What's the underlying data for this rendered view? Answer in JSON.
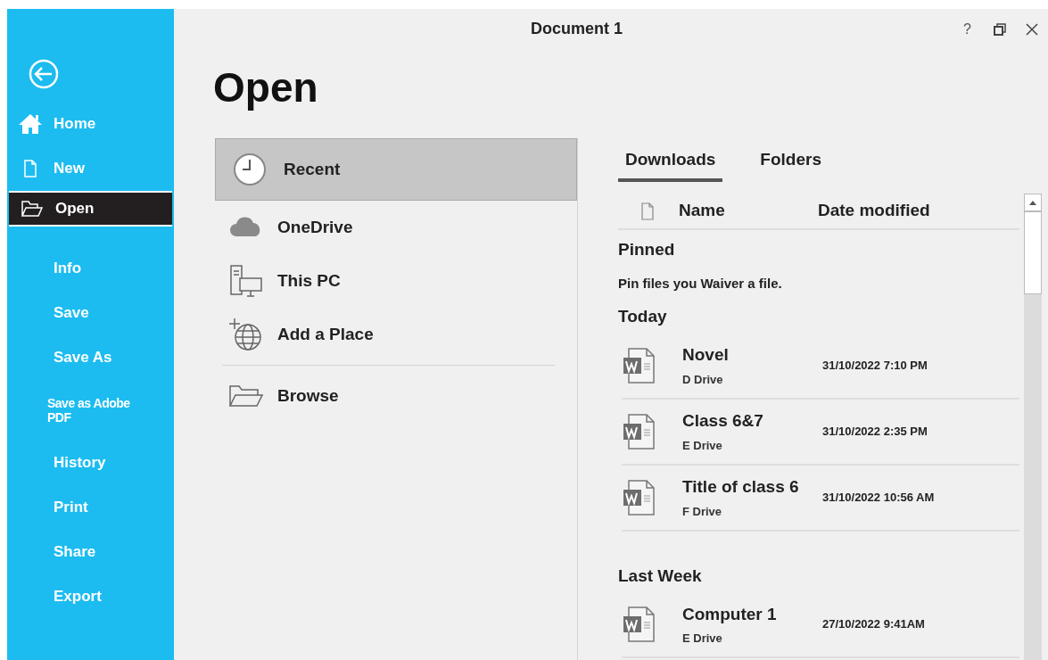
{
  "window": {
    "title": "Document 1",
    "help": "?"
  },
  "sidebar": {
    "items": [
      {
        "label": "Home",
        "kind": "icon",
        "selected": false
      },
      {
        "label": "New",
        "kind": "icon",
        "selected": false
      },
      {
        "label": "Open",
        "kind": "icon",
        "selected": true
      },
      {
        "label": "Info",
        "kind": "plain",
        "selected": false
      },
      {
        "label": "Save",
        "kind": "plain",
        "selected": false
      },
      {
        "label": "Save As",
        "kind": "plain",
        "selected": false
      },
      {
        "label": "Save as Adobe PDF",
        "kind": "compact",
        "selected": false
      },
      {
        "label": "History",
        "kind": "plain",
        "selected": false
      },
      {
        "label": "Print",
        "kind": "plain",
        "selected": false
      },
      {
        "label": "Share",
        "kind": "plain",
        "selected": false
      },
      {
        "label": "Export",
        "kind": "plain",
        "selected": false
      }
    ]
  },
  "heading": "Open",
  "places": [
    {
      "label": "Recent",
      "selected": true
    },
    {
      "label": "OneDrive",
      "selected": false
    },
    {
      "label": "This PC",
      "selected": false
    },
    {
      "label": "Add a Place",
      "selected": false
    }
  ],
  "browse": {
    "label": "Browse"
  },
  "tabs": [
    {
      "label": "Downloads",
      "selected": true
    },
    {
      "label": "Folders",
      "selected": false
    }
  ],
  "columns": [
    "Name",
    "Date modified"
  ],
  "sections": [
    {
      "title": "Pinned",
      "note": "Pin files you Waiver a file."
    },
    {
      "title": "Today",
      "files": [
        {
          "name": "Novel",
          "location": "D Drive",
          "date": "31/10/2022 7:10 PM"
        },
        {
          "name": "Class 6&7",
          "location": "E Drive",
          "date": "31/10/2022 2:35 PM"
        },
        {
          "name": "Title of class 6",
          "location": "F Drive",
          "date": "31/10/2022 10:56 AM"
        }
      ]
    },
    {
      "title": "Last Week",
      "files": [
        {
          "name": "Computer 1",
          "location": "E Drive",
          "date": "27/10/2022 9:41AM"
        }
      ]
    }
  ]
}
